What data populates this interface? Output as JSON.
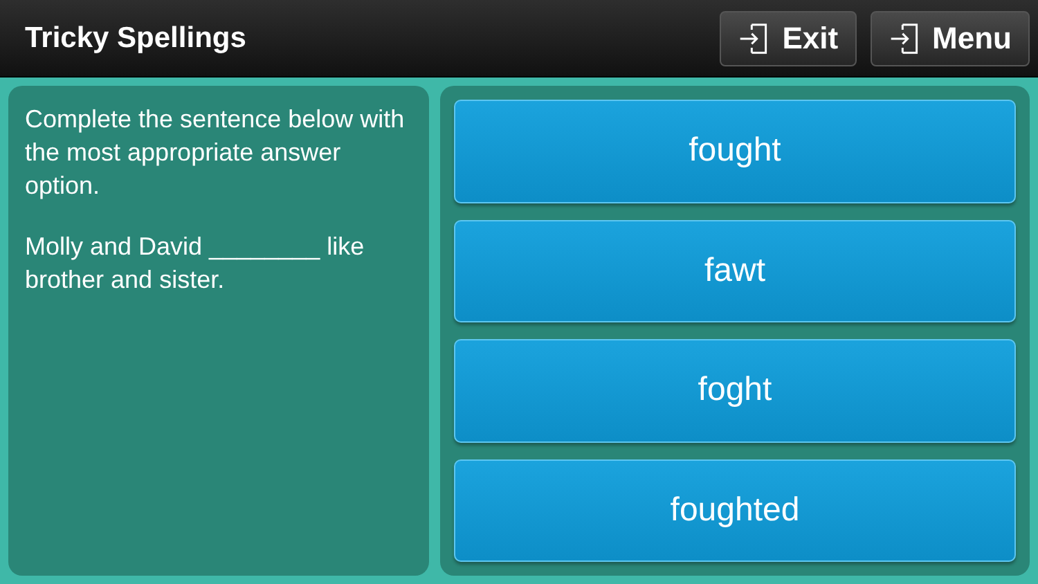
{
  "header": {
    "title": "Tricky Spellings",
    "buttons": [
      {
        "label": "Exit"
      },
      {
        "label": "Menu"
      }
    ]
  },
  "question": {
    "instruction": "Complete the sentence below with the most appropriate answer option.",
    "sentence": "Molly and David ________ like brother and sister."
  },
  "answers": [
    {
      "label": "fought"
    },
    {
      "label": "fawt"
    },
    {
      "label": "foght"
    },
    {
      "label": "foughted"
    }
  ]
}
